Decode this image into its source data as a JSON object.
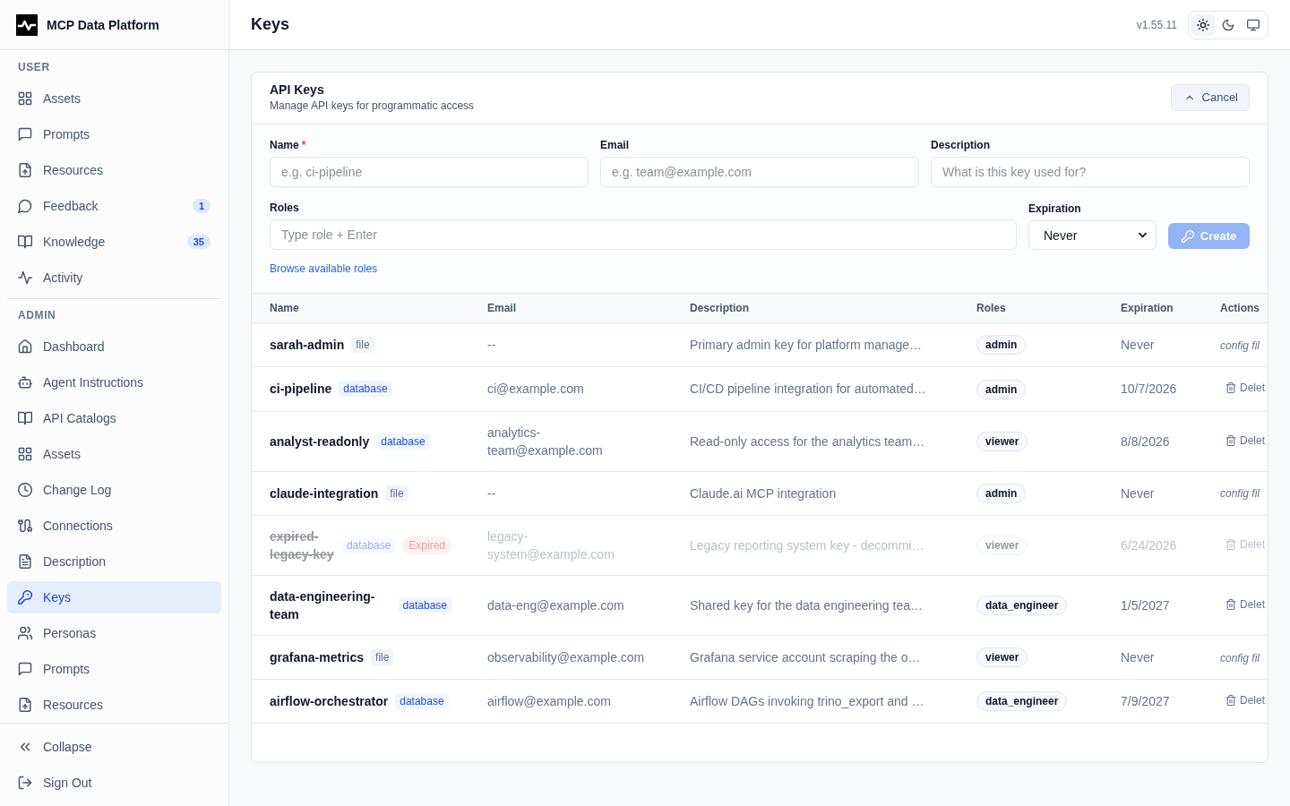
{
  "sidebar": {
    "brand": "MCP Data Platform",
    "sections": [
      {
        "title": "USER",
        "items": [
          {
            "label": "Assets",
            "selected": false
          },
          {
            "label": "Prompts",
            "selected": false
          },
          {
            "label": "Resources",
            "selected": false
          },
          {
            "label": "Feedback",
            "badge": "1",
            "selected": false
          },
          {
            "label": "Knowledge",
            "badge": "35",
            "selected": false
          },
          {
            "label": "Activity",
            "selected": false
          }
        ]
      },
      {
        "title": "ADMIN",
        "items": [
          {
            "label": "Dashboard",
            "selected": false
          },
          {
            "label": "Agent Instructions",
            "selected": false
          },
          {
            "label": "API Catalogs",
            "selected": false
          },
          {
            "label": "Assets",
            "selected": false
          },
          {
            "label": "Change Log",
            "selected": false
          },
          {
            "label": "Connections",
            "selected": false
          },
          {
            "label": "Description",
            "selected": false
          },
          {
            "label": "Keys",
            "selected": true
          },
          {
            "label": "Personas",
            "selected": false
          },
          {
            "label": "Prompts",
            "selected": false
          },
          {
            "label": "Resources",
            "selected": false
          }
        ]
      }
    ],
    "footer_items": [
      "Collapse",
      "Sign Out"
    ]
  },
  "header": {
    "title": "Keys",
    "version": "v1.55.11",
    "theme_options": [
      {
        "selected": true
      },
      {
        "selected": false
      },
      {
        "selected": false
      }
    ]
  },
  "api_keys_panel": {
    "title": "API Keys",
    "subtitle": "Manage API keys for programmatic access",
    "cancel_button": "Cancel",
    "form": {
      "fields": [
        {
          "label": "Name",
          "required_mark": "*",
          "placeholder": "e.g. ci-pipeline"
        },
        {
          "label": "Email",
          "placeholder": "e.g. team@example.com"
        },
        {
          "label": "Description",
          "placeholder": "What is this key used for?"
        }
      ],
      "roles": {
        "label": "Roles",
        "placeholder": "Type role + Enter"
      },
      "expiration": {
        "label": "Expiration",
        "value": "Never"
      },
      "create_button": {
        "label": "Create",
        "disabled": true
      },
      "browse_link": "Browse available roles"
    },
    "table": {
      "columns": [
        "Name",
        "Email",
        "Description",
        "Roles",
        "Expiration",
        "Actions"
      ],
      "rows": [
        {
          "name": "sarah-admin",
          "source": {
            "kind": "file",
            "label": "file"
          },
          "expired": false,
          "email": "--",
          "description": "Primary admin key for platform manage…",
          "roles": [
            "admin"
          ],
          "expiration": "Never",
          "action": {
            "kind": "note",
            "label": "config fil"
          }
        },
        {
          "name": "ci-pipeline",
          "source": {
            "kind": "database",
            "label": "database"
          },
          "expired": false,
          "email": "ci@example.com",
          "description": "CI/CD pipeline integration for automated…",
          "roles": [
            "admin"
          ],
          "expiration": "10/7/2026",
          "action": {
            "kind": "delete",
            "label": "Delet"
          }
        },
        {
          "name": "analyst-readonly",
          "source": {
            "kind": "database",
            "label": "database"
          },
          "expired": false,
          "email": "analytics-team@example.com",
          "description": "Read-only access for the analytics team…",
          "roles": [
            "viewer"
          ],
          "expiration": "8/8/2026",
          "action": {
            "kind": "delete",
            "label": "Delet"
          }
        },
        {
          "name": "claude-integration",
          "source": {
            "kind": "file",
            "label": "file"
          },
          "expired": false,
          "email": "--",
          "description": "Claude.ai MCP integration",
          "roles": [
            "admin"
          ],
          "expiration": "Never",
          "action": {
            "kind": "note",
            "label": "config fil"
          }
        },
        {
          "name": "expired-legacy-key",
          "source": {
            "kind": "database",
            "label": "database"
          },
          "status": "Expired",
          "expired": true,
          "email": "legacy-system@example.com",
          "description": "Legacy reporting system key - decommi…",
          "roles": [
            "viewer"
          ],
          "expiration": "6/24/2026",
          "action": {
            "kind": "delete",
            "label": "Delet"
          }
        },
        {
          "name": "data-engineering-team",
          "source": {
            "kind": "database",
            "label": "database"
          },
          "expired": false,
          "email": "data-eng@example.com",
          "description": "Shared key for the data engineering tea…",
          "roles": [
            "data_engineer"
          ],
          "expiration": "1/5/2027",
          "action": {
            "kind": "delete",
            "label": "Delet"
          }
        },
        {
          "name": "grafana-metrics",
          "source": {
            "kind": "file",
            "label": "file"
          },
          "expired": false,
          "email": "observability@example.com",
          "description": "Grafana service account scraping the o…",
          "roles": [
            "viewer"
          ],
          "expiration": "Never",
          "action": {
            "kind": "note",
            "label": "config fil"
          }
        },
        {
          "name": "airflow-orchestrator",
          "source": {
            "kind": "database",
            "label": "database"
          },
          "expired": false,
          "email": "airflow@example.com",
          "description": "Airflow DAGs invoking trino_export and …",
          "roles": [
            "data_engineer"
          ],
          "expiration": "7/9/2027",
          "action": {
            "kind": "delete",
            "label": "Delet"
          }
        }
      ]
    }
  }
}
